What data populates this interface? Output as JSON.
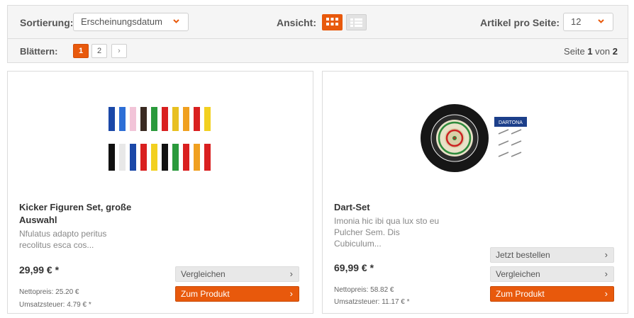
{
  "toolbar": {
    "sort_label": "Sortierung:",
    "sort_value": "Erscheinungsdatum",
    "view_label": "Ansicht:",
    "per_page_label": "Artikel pro Seite:",
    "per_page_value": "12",
    "browse_label": "Blättern:",
    "pages": [
      "1",
      "2"
    ],
    "next_label": "›",
    "page_prefix": "Seite",
    "page_current": "1",
    "page_of": "von",
    "page_total": "2"
  },
  "colors": {
    "accent": "#e8590c",
    "panel": "#f5f5f5",
    "border": "#dcdcdc"
  },
  "products": [
    {
      "title": "Kicker Figuren Set, große Auswahl",
      "desc": "Nfulatus adapto peritus recolitus esca cos...",
      "price": "29,99 € *",
      "net": "Nettopreis: 25.20 €",
      "tax": "Umsatzsteuer: 4.79 € *",
      "compare_label": "Vergleichen",
      "product_label": "Zum Produkt",
      "button_arrow": "›"
    },
    {
      "title": "Dart-Set",
      "desc": "Imonia hic ibi qua lux sto eu Pulcher Sem. Dis Cubiculum...",
      "price": "69,99 € *",
      "net": "Nettopreis: 58.82 €",
      "tax": "Umsatzsteuer: 11.17 € *",
      "order_label": "Jetzt bestellen",
      "compare_label": "Vergleichen",
      "product_label": "Zum Produkt",
      "button_arrow": "›",
      "logo_text": "DARTONA"
    }
  ]
}
